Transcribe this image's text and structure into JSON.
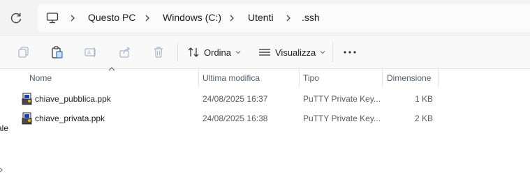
{
  "address_bar": {
    "refresh_icon": "refresh-icon",
    "pc_icon": "computer-icon",
    "breadcrumbs": [
      "Questo PC",
      "Windows (C:)",
      "Utenti",
      ".ssh"
    ]
  },
  "toolbar": {
    "icons": [
      "copy-icon",
      "paste-icon",
      "rename-icon",
      "share-icon",
      "delete-icon"
    ],
    "sort_label": "Ordina",
    "view_label": "Visualizza",
    "more_icon": "more-options-icon"
  },
  "columns": {
    "name": "Nome",
    "modified": "Ultima modifica",
    "type": "Tipo",
    "size": "Dimensione"
  },
  "files": [
    {
      "name": "chiave_pubblica.ppk",
      "modified": "24/08/2025 16:37",
      "type": "PuTTY Private Key...",
      "size": "1 KB",
      "icon": "putty-key-icon"
    },
    {
      "name": "chiave_privata.ppk",
      "modified": "24/08/2025 16:38",
      "type": "PuTTY Private Key...",
      "size": "2 KB",
      "icon": "putty-key-icon"
    }
  ],
  "left_pane_clipped_text": "ale"
}
